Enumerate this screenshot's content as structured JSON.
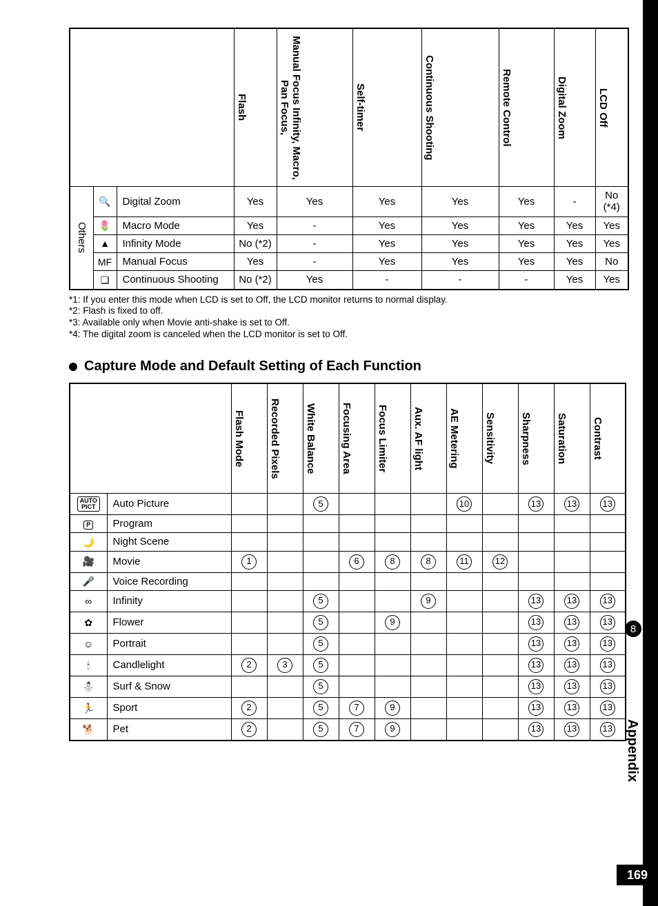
{
  "table1": {
    "headers": [
      "Flash",
      "Manual Focus\nInfinity,\nMacro, Pan Focus,",
      "Self-timer",
      "Continuous Shooting",
      "Remote Control",
      "Digital Zoom",
      "LCD Off"
    ],
    "group_label": "Others",
    "rows": [
      {
        "icon": "🔍",
        "label": "Digital Zoom",
        "v": [
          "Yes",
          "Yes",
          "Yes",
          "Yes",
          "Yes",
          "-",
          "No (*4)"
        ]
      },
      {
        "icon": "🌷",
        "label": "Macro Mode",
        "v": [
          "Yes",
          "-",
          "Yes",
          "Yes",
          "Yes",
          "Yes",
          "Yes"
        ]
      },
      {
        "icon": "▲",
        "label": "Infinity Mode",
        "v": [
          "No (*2)",
          "-",
          "Yes",
          "Yes",
          "Yes",
          "Yes",
          "Yes"
        ]
      },
      {
        "icon": "MF",
        "label": "Manual Focus",
        "v": [
          "Yes",
          "-",
          "Yes",
          "Yes",
          "Yes",
          "Yes",
          "No"
        ]
      },
      {
        "icon": "❏",
        "label": "Continuous Shooting",
        "v": [
          "No (*2)",
          "Yes",
          "-",
          "-",
          "-",
          "Yes",
          "Yes"
        ]
      }
    ]
  },
  "notes": [
    "*1: If you enter this mode when LCD is set to Off, the LCD monitor returns to normal display.",
    "*2: Flash is fixed to off.",
    "*3: Available only when Movie anti-shake is set to Off.",
    "*4: The digital zoom is canceled when the LCD monitor is set to Off."
  ],
  "section_title": "Capture Mode and Default Setting of Each Function",
  "table2": {
    "headers": [
      "Flash Mode",
      "Recorded Pixels",
      "White Balance",
      "Focusing Area",
      "Focus Limiter",
      "Aux. AF light",
      "AE Metering",
      "Sensitivity",
      "Sharpness",
      "Saturation",
      "Contrast"
    ],
    "rows": [
      {
        "icon": "AUTO PICT",
        "label": "Auto Picture",
        "v": [
          "",
          "",
          "5",
          "",
          "",
          "",
          "10",
          "",
          "13",
          "13",
          "13"
        ]
      },
      {
        "icon": "P",
        "label": "Program",
        "v": [
          "",
          "",
          "",
          "",
          "",
          "",
          "",
          "",
          "",
          "",
          ""
        ]
      },
      {
        "icon": "🌙",
        "label": "Night Scene",
        "v": [
          "",
          "",
          "",
          "",
          "",
          "",
          "",
          "",
          "",
          "",
          ""
        ]
      },
      {
        "icon": "🎥",
        "label": "Movie",
        "v": [
          "1",
          "",
          "",
          "6",
          "8",
          "8",
          "11",
          "12",
          "",
          "",
          ""
        ]
      },
      {
        "icon": "🎤",
        "label": "Voice Recording",
        "v": [
          "",
          "",
          "",
          "",
          "",
          "",
          "",
          "",
          "",
          "",
          ""
        ]
      },
      {
        "icon": "∞",
        "label": "Infinity",
        "v": [
          "",
          "",
          "5",
          "",
          "",
          "9",
          "",
          "",
          "13",
          "13",
          "13"
        ]
      },
      {
        "icon": "✿",
        "label": "Flower",
        "v": [
          "",
          "",
          "5",
          "",
          "9",
          "",
          "",
          "",
          "13",
          "13",
          "13"
        ]
      },
      {
        "icon": "☺",
        "label": "Portrait",
        "v": [
          "",
          "",
          "5",
          "",
          "",
          "",
          "",
          "",
          "13",
          "13",
          "13"
        ]
      },
      {
        "icon": "🕯",
        "label": "Candlelight",
        "v": [
          "2",
          "3",
          "5",
          "",
          "",
          "",
          "",
          "",
          "13",
          "13",
          "13"
        ]
      },
      {
        "icon": "⛄",
        "label": "Surf & Snow",
        "v": [
          "",
          "",
          "5",
          "",
          "",
          "",
          "",
          "",
          "13",
          "13",
          "13"
        ]
      },
      {
        "icon": "🏃",
        "label": "Sport",
        "v": [
          "2",
          "",
          "5",
          "7",
          "9",
          "",
          "",
          "",
          "13",
          "13",
          "13"
        ]
      },
      {
        "icon": "🐕",
        "label": "Pet",
        "v": [
          "2",
          "",
          "5",
          "7",
          "9",
          "",
          "",
          "",
          "13",
          "13",
          "13"
        ]
      }
    ]
  },
  "sidebar": {
    "chapter_num": "8",
    "chapter_title": "Appendix",
    "page": "169"
  },
  "chart_data": [
    {
      "type": "table",
      "title": "Others settings compatibility matrix",
      "columns": [
        "Flash",
        "Manual Focus / Infinity / Macro / Pan Focus",
        "Self-timer",
        "Continuous Shooting",
        "Remote Control",
        "Digital Zoom",
        "LCD Off"
      ],
      "rows": [
        {
          "mode": "Digital Zoom",
          "values": [
            "Yes",
            "Yes",
            "Yes",
            "Yes",
            "Yes",
            "-",
            "No (*4)"
          ]
        },
        {
          "mode": "Macro Mode",
          "values": [
            "Yes",
            "-",
            "Yes",
            "Yes",
            "Yes",
            "Yes",
            "Yes"
          ]
        },
        {
          "mode": "Infinity Mode",
          "values": [
            "No (*2)",
            "-",
            "Yes",
            "Yes",
            "Yes",
            "Yes",
            "Yes"
          ]
        },
        {
          "mode": "Manual Focus",
          "values": [
            "Yes",
            "-",
            "Yes",
            "Yes",
            "Yes",
            "Yes",
            "No"
          ]
        },
        {
          "mode": "Continuous Shooting",
          "values": [
            "No (*2)",
            "Yes",
            "-",
            "-",
            "-",
            "Yes",
            "Yes"
          ]
        }
      ]
    },
    {
      "type": "table",
      "title": "Capture Mode and Default Setting of Each Function",
      "columns": [
        "Flash Mode",
        "Recorded Pixels",
        "White Balance",
        "Focusing Area",
        "Focus Limiter",
        "Aux. AF light",
        "AE Metering",
        "Sensitivity",
        "Sharpness",
        "Saturation",
        "Contrast"
      ],
      "rows": [
        {
          "mode": "Auto Picture",
          "values": [
            null,
            null,
            5,
            null,
            null,
            null,
            10,
            null,
            13,
            13,
            13
          ]
        },
        {
          "mode": "Program",
          "values": [
            null,
            null,
            null,
            null,
            null,
            null,
            null,
            null,
            null,
            null,
            null
          ]
        },
        {
          "mode": "Night Scene",
          "values": [
            null,
            null,
            null,
            null,
            null,
            null,
            null,
            null,
            null,
            null,
            null
          ]
        },
        {
          "mode": "Movie",
          "values": [
            1,
            null,
            null,
            6,
            8,
            8,
            11,
            12,
            null,
            null,
            null
          ]
        },
        {
          "mode": "Voice Recording",
          "values": [
            null,
            null,
            null,
            null,
            null,
            null,
            null,
            null,
            null,
            null,
            null
          ]
        },
        {
          "mode": "Infinity",
          "values": [
            null,
            null,
            5,
            null,
            null,
            9,
            null,
            null,
            13,
            13,
            13
          ]
        },
        {
          "mode": "Flower",
          "values": [
            null,
            null,
            5,
            null,
            9,
            null,
            null,
            null,
            13,
            13,
            13
          ]
        },
        {
          "mode": "Portrait",
          "values": [
            null,
            null,
            5,
            null,
            null,
            null,
            null,
            null,
            13,
            13,
            13
          ]
        },
        {
          "mode": "Candlelight",
          "values": [
            2,
            3,
            5,
            null,
            null,
            null,
            null,
            null,
            13,
            13,
            13
          ]
        },
        {
          "mode": "Surf & Snow",
          "values": [
            null,
            null,
            5,
            null,
            null,
            null,
            null,
            null,
            13,
            13,
            13
          ]
        },
        {
          "mode": "Sport",
          "values": [
            2,
            null,
            5,
            7,
            9,
            null,
            null,
            null,
            13,
            13,
            13
          ]
        },
        {
          "mode": "Pet",
          "values": [
            2,
            null,
            5,
            7,
            9,
            null,
            null,
            null,
            13,
            13,
            13
          ]
        }
      ]
    }
  ]
}
